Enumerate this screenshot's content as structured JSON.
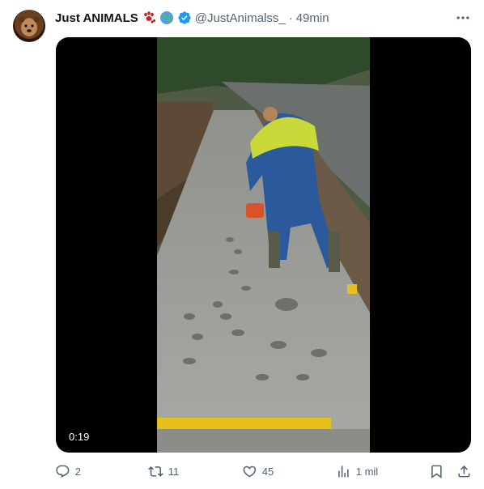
{
  "post": {
    "author": {
      "display_name": "Just ANIMALS",
      "handle": "@JustAnimalss_",
      "verified": true,
      "badges": [
        "paw-prints-emoji",
        "globe-emoji"
      ]
    },
    "separator": "·",
    "time_ago": "49min",
    "media": {
      "type": "video",
      "duration": "0:19"
    },
    "actions": {
      "replies": "2",
      "reposts": "11",
      "likes": "45",
      "views": "1 mil"
    }
  },
  "colors": {
    "text": "#0f1419",
    "secondary": "#536471",
    "verified": "#1d9bf0"
  }
}
